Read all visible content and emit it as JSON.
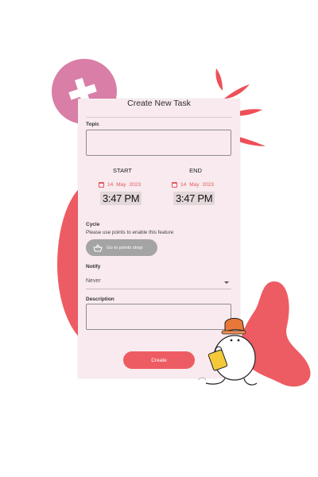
{
  "form": {
    "title": "Create New Task",
    "topic_label": "Topic",
    "topic_value": "",
    "start": {
      "heading": "START",
      "day": "14",
      "month": "May",
      "year": "2023",
      "time": "3:47 PM"
    },
    "end": {
      "heading": "END",
      "day": "14",
      "month": "May",
      "year": "2023",
      "time": "3:47 PM"
    },
    "cycle_label": "Cycle",
    "cycle_note": "Please use points to enable this feature",
    "points_button": "Go to points shop",
    "notify_label": "Notify",
    "notify_value": "Never",
    "description_label": "Description",
    "description_value": "",
    "create_button": "Create"
  },
  "colors": {
    "accent": "#ee5c63",
    "card_bg": "#f8eaee",
    "pink_circle": "#d97ea7",
    "button_gray": "#a4a4a4"
  },
  "icons": [
    "calendar-icon",
    "basket-icon",
    "dropdown-caret-icon",
    "plus-icon"
  ]
}
